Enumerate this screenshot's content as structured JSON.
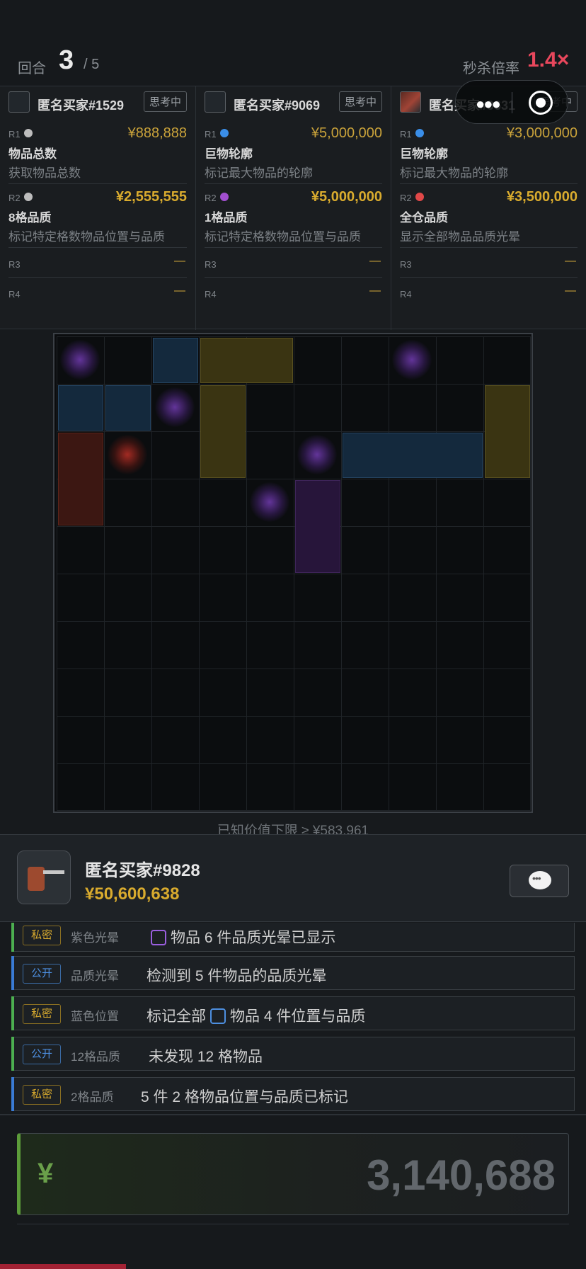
{
  "header": {
    "round_label": "回合",
    "round_current": "3",
    "round_total": "/ 5",
    "rate_label": "秒杀倍率",
    "rate_value": "1.4×"
  },
  "buyers": [
    {
      "name": "匿名买家#1529",
      "status": "思考中",
      "avatar": "flashlight-icon",
      "r1": {
        "label": "R1",
        "dot_color": "#bdbdbd",
        "price": "¥888,888",
        "title": "物品总数",
        "desc": "获取物品总数"
      },
      "r2": {
        "label": "R2",
        "dot_color": "#bdbdbd",
        "price": "¥2,555,555",
        "title": "8格品质",
        "desc": "标记特定格数物品位置与品质"
      },
      "r3": {
        "label": "R3",
        "value": "—"
      },
      "r4": {
        "label": "R4",
        "value": "—"
      }
    },
    {
      "name": "匿名买家#9069",
      "status": "思考中",
      "avatar": "blank-avatar-icon",
      "r1": {
        "label": "R1",
        "dot_color": "#3a8ee8",
        "price": "¥5,000,000",
        "title": "巨物轮廓",
        "desc": "标记最大物品的轮廓"
      },
      "r2": {
        "label": "R2",
        "dot_color": "#a24fd0",
        "price": "¥5,000,000",
        "title": "1格品质",
        "desc": "标记特定格数物品位置与品质"
      },
      "r3": {
        "label": "R3",
        "value": "—"
      },
      "r4": {
        "label": "R4",
        "value": "—"
      }
    },
    {
      "name": "匿名买家#9631",
      "status": "思考中",
      "avatar": "drill-icon",
      "r1": {
        "label": "R1",
        "dot_color": "#3a8ee8",
        "price": "¥3,000,000",
        "title": "巨物轮廓",
        "desc": "标记最大物品的轮廓"
      },
      "r2": {
        "label": "R2",
        "dot_color": "#e04848",
        "price": "¥3,500,000",
        "title": "全仓品质",
        "desc": "显示全部物品品质光晕"
      },
      "r3": {
        "label": "R3",
        "value": "—"
      },
      "r4": {
        "label": "R4",
        "value": "—"
      }
    }
  ],
  "grid": {
    "columns": 10,
    "rows": 10,
    "items": [
      {
        "col": 2,
        "row": 0,
        "w": 1,
        "h": 1,
        "color": "blue"
      },
      {
        "col": 3,
        "row": 0,
        "w": 2,
        "h": 1,
        "color": "yellow"
      },
      {
        "col": 0,
        "row": 1,
        "w": 1,
        "h": 1,
        "color": "blue"
      },
      {
        "col": 1,
        "row": 1,
        "w": 1,
        "h": 1,
        "color": "blue"
      },
      {
        "col": 3,
        "row": 1,
        "w": 1,
        "h": 2,
        "color": "yellow"
      },
      {
        "col": 9,
        "row": 1,
        "w": 1,
        "h": 2,
        "color": "yellow"
      },
      {
        "col": 0,
        "row": 2,
        "w": 1,
        "h": 2,
        "color": "red"
      },
      {
        "col": 6,
        "row": 2,
        "w": 3,
        "h": 1,
        "color": "blue"
      },
      {
        "col": 5,
        "row": 3,
        "w": 1,
        "h": 2,
        "color": "purple"
      }
    ],
    "glows": [
      {
        "col": 0,
        "row": 0,
        "color": "purple"
      },
      {
        "col": 7,
        "row": 0,
        "color": "purple"
      },
      {
        "col": 2,
        "row": 1,
        "color": "purple"
      },
      {
        "col": 1,
        "row": 2,
        "color": "red"
      },
      {
        "col": 5,
        "row": 2,
        "color": "purple"
      },
      {
        "col": 4,
        "row": 3,
        "color": "purple"
      }
    ]
  },
  "lower_bound": "已知价值下限 ≥ ¥583,961",
  "player": {
    "name": "匿名买家#9828",
    "money": "¥50,600,638",
    "avatar": "drill-icon"
  },
  "logs": [
    {
      "tag": "私密",
      "tag_type": "private",
      "bar": "green",
      "category": "紫色光晕",
      "text_before": "",
      "square": "purple",
      "text_after": "物品 6 件品质光晕已显示"
    },
    {
      "tag": "公开",
      "tag_type": "public",
      "bar": "blue",
      "category": "品质光晕",
      "text_before": "检测到 5 件物品的品质光晕",
      "square": "",
      "text_after": ""
    },
    {
      "tag": "私密",
      "tag_type": "private",
      "bar": "green",
      "category": "蓝色位置",
      "text_before": "标记全部",
      "square": "blue",
      "text_after": "物品 4 件位置与品质"
    },
    {
      "tag": "公开",
      "tag_type": "public",
      "bar": "green",
      "category": "12格品质",
      "text_before": "未发现 12 格物品",
      "square": "",
      "text_after": ""
    },
    {
      "tag": "私密",
      "tag_type": "private",
      "bar": "blue",
      "category": "2格品质",
      "text_before": "5 件 2 格物品位置与品质已标记",
      "square": "",
      "text_after": ""
    }
  ],
  "bid": {
    "currency": "¥",
    "value": "3,140,688"
  }
}
